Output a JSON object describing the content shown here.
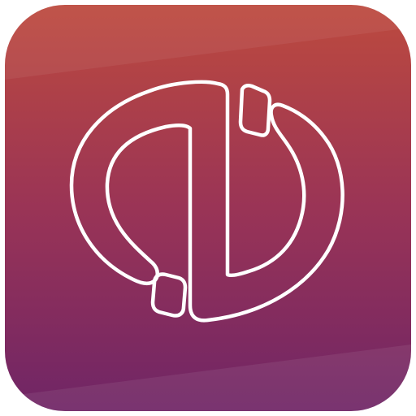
{
  "icon": {
    "name": "app-logo-icon",
    "gradient_top": "#bd4a3e",
    "gradient_mid": "#9a3456",
    "gradient_bottom": "#6f2566",
    "stroke_color": "#ffffff"
  }
}
